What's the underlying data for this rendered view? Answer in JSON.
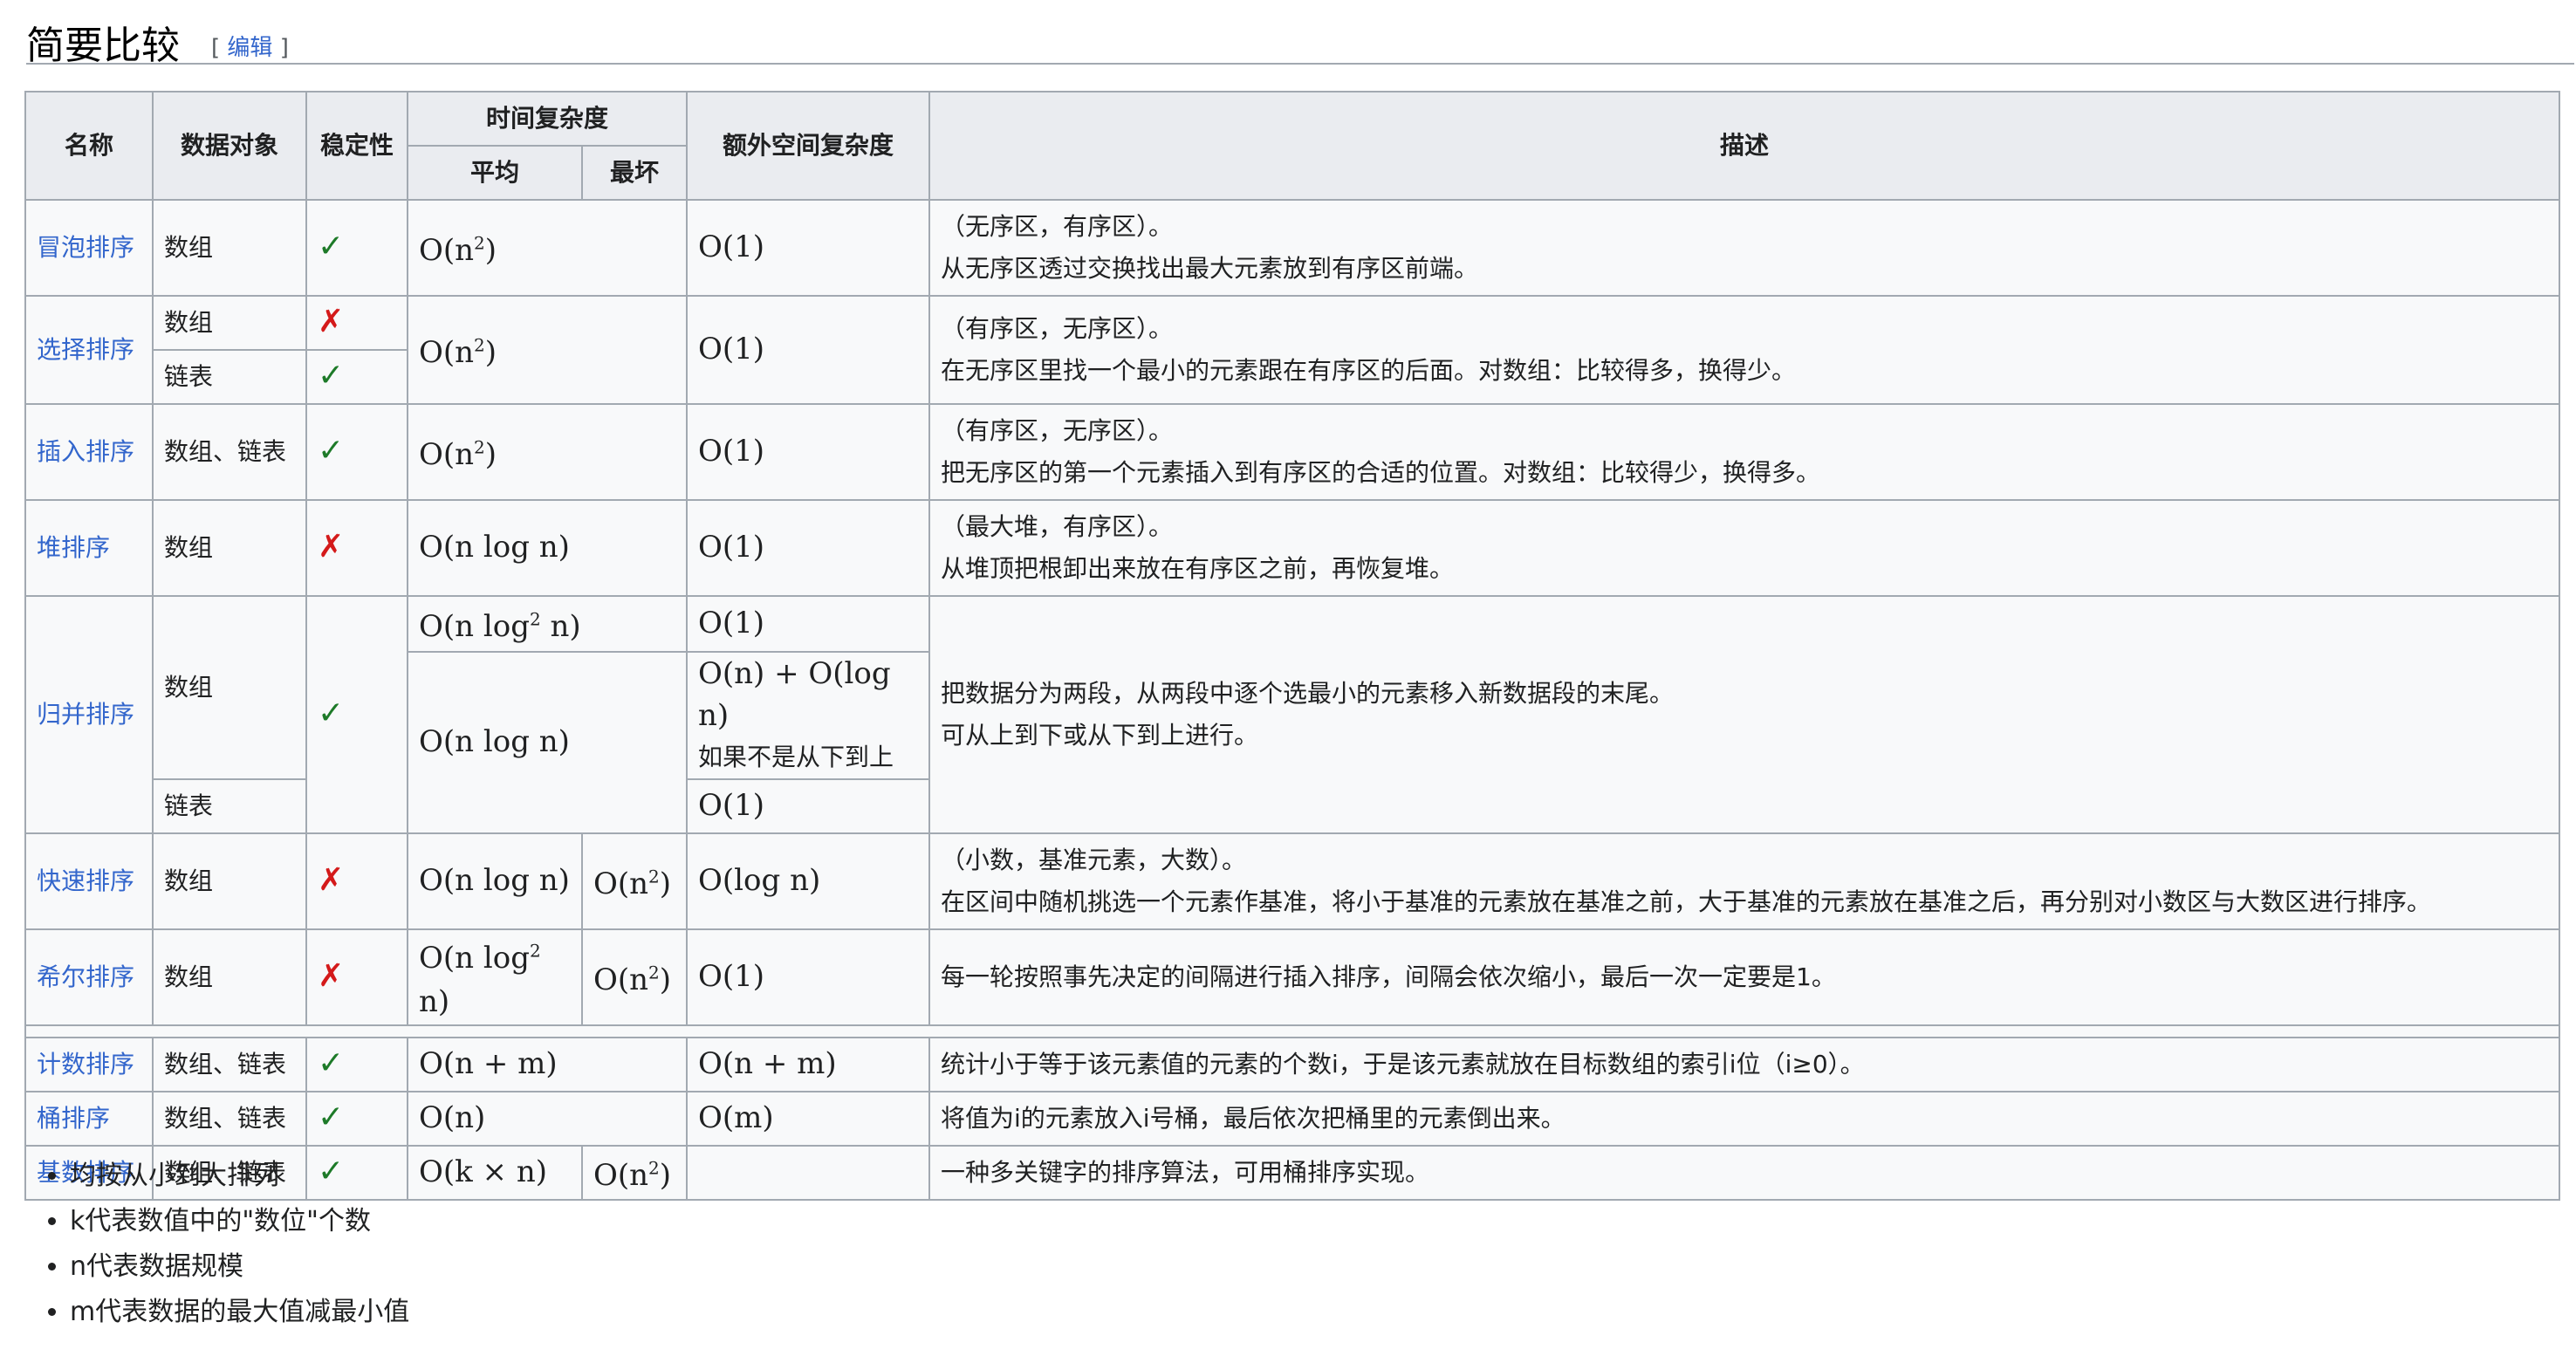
{
  "section": {
    "title": "简要比较",
    "edit_open": "[",
    "edit_label": "编辑",
    "edit_close": "]"
  },
  "table": {
    "headers": {
      "name": "名称",
      "data_object": "数据对象",
      "stability": "稳定性",
      "time": "时间复杂度",
      "avg": "平均",
      "worst": "最坏",
      "space": "额外空间复杂度",
      "desc": "描述"
    },
    "rows": {
      "bubble": {
        "name": "冒泡排序",
        "obj": "数组",
        "stable": "✓",
        "avg_base": "O(n",
        "avg_exp": "2",
        "avg_tail": ")",
        "space": "O(1)",
        "desc1": "（无序区，有序区）。",
        "desc2": "从无序区透过交换找出最大元素放到有序区前端。"
      },
      "select": {
        "name": "选择排序",
        "obj1": "数组",
        "stable1": "✗",
        "obj2": "链表",
        "stable2": "✓",
        "avg_base": "O(n",
        "avg_exp": "2",
        "avg_tail": ")",
        "space": "O(1)",
        "desc1": "（有序区，无序区）。",
        "desc2": "在无序区里找一个最小的元素跟在有序区的后面。对数组：比较得多，换得少。"
      },
      "insert": {
        "name": "插入排序",
        "obj": "数组、链表",
        "stable": "✓",
        "avg_base": "O(n",
        "avg_exp": "2",
        "avg_tail": ")",
        "space": "O(1)",
        "desc1": "（有序区，无序区）。",
        "desc2": "把无序区的第一个元素插入到有序区的合适的位置。对数组：比较得少，换得多。"
      },
      "heap": {
        "name": "堆排序",
        "obj": "数组",
        "stable": "✗",
        "avg": "O(n log n)",
        "space": "O(1)",
        "desc1": "（最大堆，有序区）。",
        "desc2": "从堆顶把根卸出来放在有序区之前，再恢复堆。"
      },
      "merge": {
        "name": "归并排序",
        "obj1": "数组",
        "obj2": "链表",
        "stable": "✓",
        "avg1_base": "O(n log",
        "avg1_exp": "2",
        "avg1_tail": " n)",
        "space1": "O(1)",
        "avg2": "O(n log n)",
        "space2": "O(n) + O(log n)",
        "space2_note": "如果不是从下到上",
        "space3": "O(1)",
        "desc1": "把数据分为两段，从两段中逐个选最小的元素移入新数据段的末尾。",
        "desc2": "可从上到下或从下到上进行。"
      },
      "quick": {
        "name": "快速排序",
        "obj": "数组",
        "stable": "✗",
        "avg": "O(n log n)",
        "worst_base": "O(n",
        "worst_exp": "2",
        "worst_tail": ")",
        "space": "O(log n)",
        "desc1": "（小数，基准元素，大数）。",
        "desc2": "在区间中随机挑选一个元素作基准，将小于基准的元素放在基准之前，大于基准的元素放在基准之后，再分别对小数区与大数区进行排序。"
      },
      "shell": {
        "name": "希尔排序",
        "obj": "数组",
        "stable": "✗",
        "avg_base": "O(n log",
        "avg_exp": "2",
        "avg_tail": " n)",
        "worst_base": "O(n",
        "worst_exp": "2",
        "worst_tail": ")",
        "space": "O(1)",
        "desc": "每一轮按照事先决定的间隔进行插入排序，间隔会依次缩小，最后一次一定要是1。"
      },
      "counting": {
        "name": "计数排序",
        "obj": "数组、链表",
        "stable": "✓",
        "avg": "O(n + m)",
        "space": "O(n + m)",
        "desc": "统计小于等于该元素值的元素的个数i，于是该元素就放在目标数组的索引i位（i≥0）。"
      },
      "bucket": {
        "name": "桶排序",
        "obj": "数组、链表",
        "stable": "✓",
        "avg": "O(n)",
        "space": "O(m)",
        "desc": "将值为i的元素放入i号桶，最后依次把桶里的元素倒出来。"
      },
      "radix": {
        "name": "基数排序",
        "obj": "数组、链表",
        "stable": "✓",
        "avg": "O(k × n)",
        "worst_base": "O(n",
        "worst_exp": "2",
        "worst_tail": ")",
        "space": "",
        "desc": "一种多关键字的排序算法，可用桶排序实现。"
      }
    }
  },
  "notes": [
    "均按从小到大排列",
    "k代表数值中的\"数位\"个数",
    "n代表数据规模",
    "m代表数据的最大值减最小值"
  ]
}
